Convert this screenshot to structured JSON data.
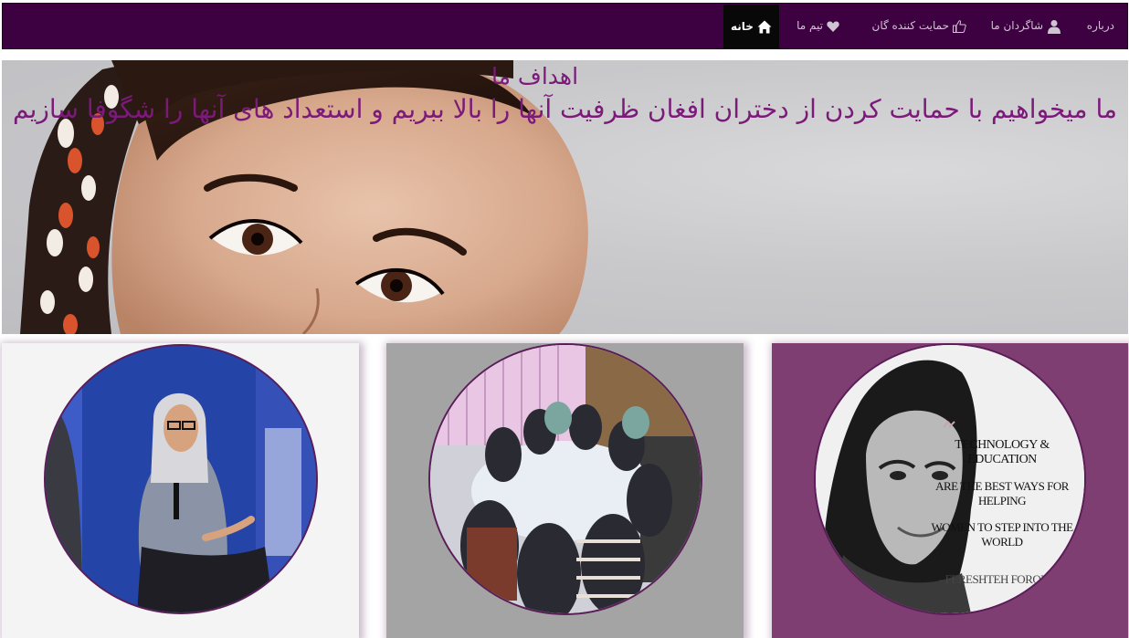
{
  "navbar": {
    "items": [
      {
        "key": "home",
        "label": "خانه",
        "icon": "home-icon"
      },
      {
        "key": "team",
        "label": "تیم ما",
        "icon": "heart-icon"
      },
      {
        "key": "supporters",
        "label": "حمایت کننده گان",
        "icon": "thumbs-up-icon"
      },
      {
        "key": "students",
        "label": "شاگردان ما",
        "icon": "user-icon"
      },
      {
        "key": "about",
        "label": "درباره",
        "icon": ""
      }
    ]
  },
  "hero": {
    "title": "اهداف ما",
    "subtitle": "ما میخواهیم با حمایت کردن از دختران افغان ظرفیت آنها را بالا ببریم و استعداد های آنها را شگوفا سازیم"
  },
  "cards": [
    {
      "image": "woman-speaking-at-conference"
    },
    {
      "image": "girls-studying-around-table"
    },
    {
      "image": "woman-portrait-with-quote",
      "quote_lines": [
        "TECHNOLOGY & EDUCATION",
        "ARE THE BEST WAYS FOR HELPING",
        "WOMEN TO STEP INTO THE WORLD"
      ],
      "quote_author": "- FERESHTEH FOROUGH"
    }
  ],
  "colors": {
    "navbar_bg": "#3d0041",
    "active_nav_bg": "#080808",
    "hero_text": "#7b1a79",
    "card3_bg": "#7e3e72"
  }
}
